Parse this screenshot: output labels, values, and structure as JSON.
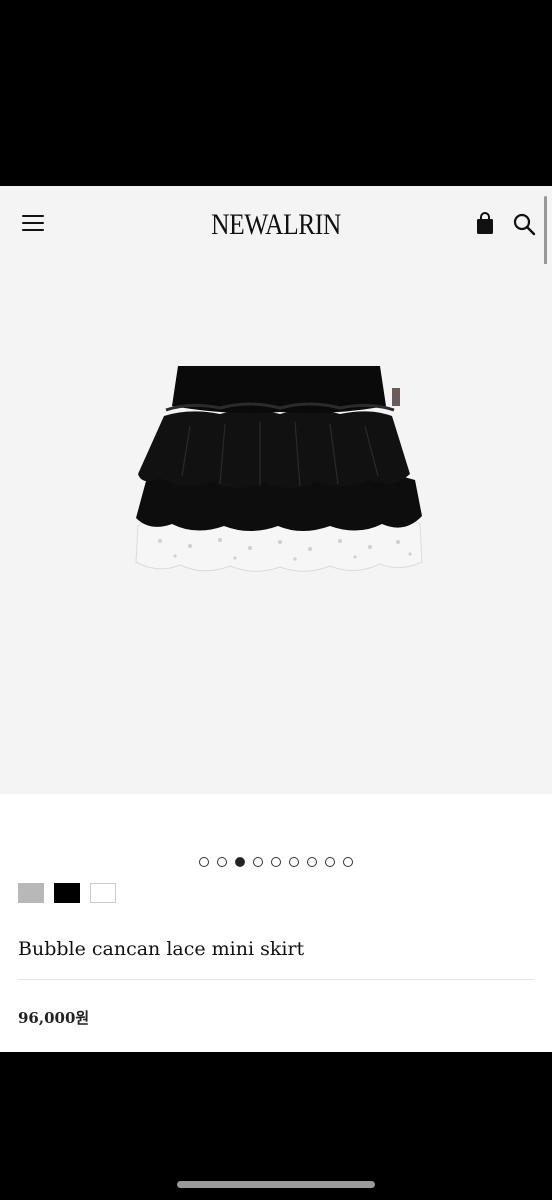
{
  "header": {
    "logo": "NEWALRIN",
    "menu_icon": "hamburger-menu-icon",
    "bag_icon": "shopping-bag-icon",
    "search_icon": "search-icon"
  },
  "gallery": {
    "image_description_icon": "product-image",
    "total_slides": 9,
    "active_slide": 3
  },
  "swatches": [
    {
      "name": "gray",
      "color": "#b8b8b8"
    },
    {
      "name": "black",
      "color": "#000000"
    },
    {
      "name": "white",
      "color": "#ffffff"
    }
  ],
  "product": {
    "title": "Bubble cancan lace mini skirt",
    "price": "96,000원"
  }
}
